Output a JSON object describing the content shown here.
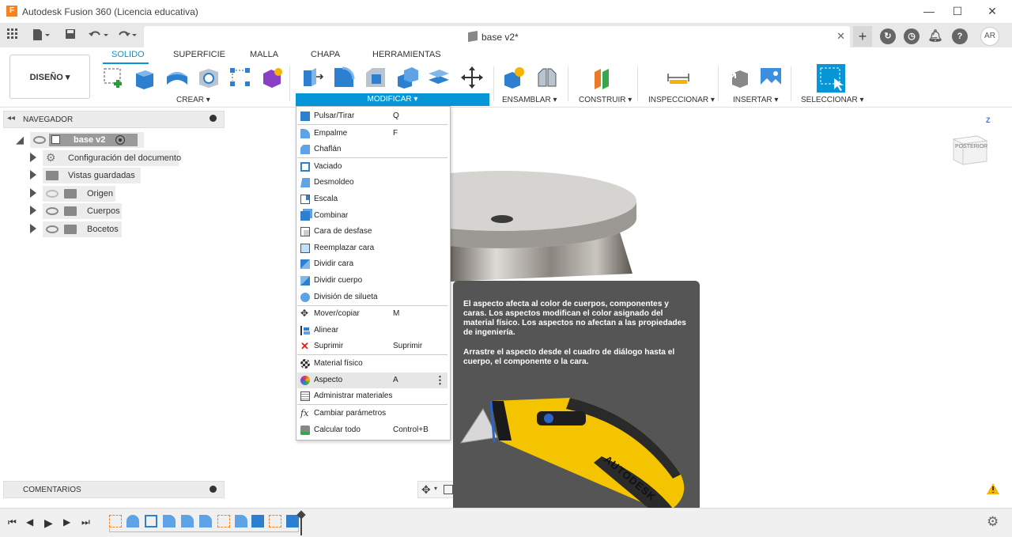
{
  "window": {
    "title": "Autodesk Fusion 360 (Licencia educativa)",
    "app_icon": "F",
    "controls": [
      "—",
      "☐",
      "✕"
    ]
  },
  "document": {
    "tab_name": "base v2*",
    "close": "✕"
  },
  "user": {
    "initials": "AR"
  },
  "workspace": {
    "label": "DISEÑO ▾"
  },
  "toolbar": {
    "tabs": [
      "SOLIDO",
      "SUPERFICIE",
      "MALLA",
      "CHAPA",
      "HERRAMIENTAS"
    ],
    "groups": {
      "crear": "CREAR ▾",
      "modificar": "MODIFICAR ▾",
      "ensamblar": "ENSAMBLAR ▾",
      "construir": "CONSTRUIR ▾",
      "inspeccionar": "INSPECCIONAR ▾",
      "insertar": "INSERTAR ▾",
      "seleccionar": "SELECCIONAR ▾"
    }
  },
  "navigator": {
    "title": "NAVEGADOR",
    "root": "base v2",
    "items": [
      "Configuración del documento",
      "Vistas guardadas",
      "Origen",
      "Cuerpos",
      "Bocetos"
    ]
  },
  "comments": {
    "title": "COMENTARIOS"
  },
  "viewcube": {
    "face": "POSTERIOR",
    "axis": "Z"
  },
  "modify_menu": {
    "items": [
      {
        "label": "Pulsar/Tirar",
        "shortcut": "Q"
      },
      {
        "label": "Empalme",
        "shortcut": "F"
      },
      {
        "label": "Chaflán",
        "shortcut": ""
      },
      {
        "label": "Vaciado",
        "shortcut": ""
      },
      {
        "label": "Desmoldeo",
        "shortcut": ""
      },
      {
        "label": "Escala",
        "shortcut": ""
      },
      {
        "label": "Combinar",
        "shortcut": ""
      },
      {
        "label": "Cara de desfase",
        "shortcut": ""
      },
      {
        "label": "Reemplazar cara",
        "shortcut": ""
      },
      {
        "label": "Dividir cara",
        "shortcut": ""
      },
      {
        "label": "Dividir cuerpo",
        "shortcut": ""
      },
      {
        "label": "División de silueta",
        "shortcut": ""
      },
      {
        "label": "Mover/copiar",
        "shortcut": "M"
      },
      {
        "label": "Alinear",
        "shortcut": ""
      },
      {
        "label": "Suprimir",
        "shortcut": "Suprimir"
      },
      {
        "label": "Material físico",
        "shortcut": ""
      },
      {
        "label": "Aspecto",
        "shortcut": "A"
      },
      {
        "label": "Administrar materiales",
        "shortcut": ""
      },
      {
        "label": "Cambiar parámetros",
        "shortcut": ""
      },
      {
        "label": "Calcular todo",
        "shortcut": "Control+B"
      }
    ],
    "more_icon": "⋮"
  },
  "tooltip": {
    "paragraph1": "El aspecto afecta al color de cuerpos, componentes y caras. Los aspectos modifican el color asignado del material físico. Los aspectos no afectan a las propiedades de ingeniería.",
    "paragraph2": "Arrastre el aspecto desde el cuadro de diálogo hasta el cuerpo, el componente o la cara.",
    "brand": "AUTODESK"
  },
  "colors": {
    "accent": "#0696d7",
    "tooltip_bg": "#555555",
    "knife_yellow": "#f5c400"
  }
}
